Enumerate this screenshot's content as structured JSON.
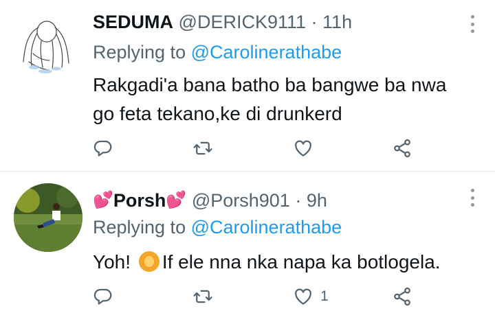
{
  "tweets": [
    {
      "name": "SEDUMA",
      "handle": "@DERICK9111",
      "separator": "·",
      "time": "11h",
      "replying_prefix": "Replying to",
      "replying_to": "@Carolinerathabe",
      "text": "Rakgadi'a bana batho ba bangwe ba nwa go feta tekano,ke di drunkerd",
      "like_count": ""
    },
    {
      "name": "Porsh",
      "name_decoration": "💕",
      "handle": "@Porsh901",
      "separator": "·",
      "time": "9h",
      "replying_prefix": "Replying to",
      "replying_to": "@Carolinerathabe",
      "text_before_emoji": "Yoh!",
      "text_after_emoji": "If ele nna nka napa ka botlogela.",
      "emoji": "person-gesturing-ok",
      "like_count": "1"
    }
  ],
  "icons": {
    "reply": "reply-icon",
    "retweet": "retweet-icon",
    "like": "heart-icon",
    "share": "share-icon",
    "more": "more-icon"
  },
  "colors": {
    "link": "#1d9bf0",
    "secondary": "#536471",
    "icon": "#536471",
    "text": "#0f1419",
    "heart": "#e0245e"
  }
}
